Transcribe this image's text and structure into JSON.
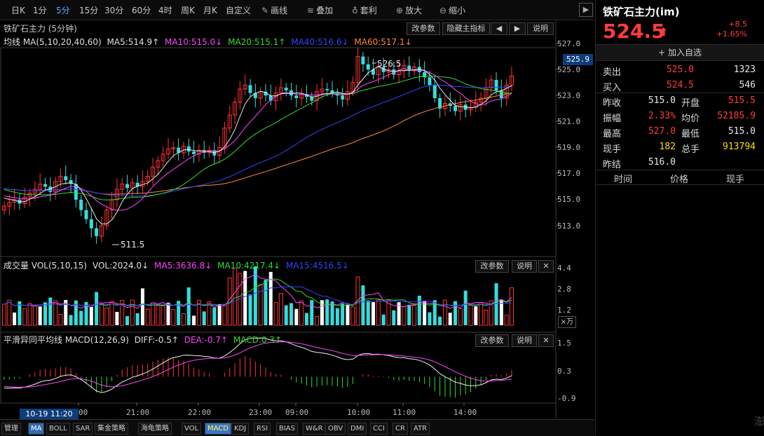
{
  "toolbar": {
    "items": [
      "日K",
      "1分",
      "5分",
      "15分",
      "30分",
      "60分",
      "4时",
      "周K",
      "月K",
      "自定义"
    ],
    "active_index": 2,
    "tools": [
      {
        "icon": "pencil-icon",
        "label": "画线"
      },
      {
        "icon": "layers-icon",
        "label": "叠加"
      },
      {
        "icon": "money-bag-icon",
        "label": "套利"
      },
      {
        "icon": "zoom-in-icon",
        "label": "放大"
      },
      {
        "icon": "zoom-out-icon",
        "label": "缩小"
      }
    ]
  },
  "main_panel": {
    "title": "铁矿石主力 (5分钟)",
    "buttons": [
      "改参数",
      "隐藏主指标",
      "◀",
      "▶",
      "说明"
    ],
    "ma_legend": [
      {
        "text": "均线 MA(5,10,20,40,60)",
        "color": "#e0e0e0"
      },
      {
        "text": "MA5:514.9↑",
        "color": "#e0e0e0"
      },
      {
        "text": "MA10:515.0↓",
        "color": "#ff44ff"
      },
      {
        "text": "MA20:515.1↑",
        "color": "#33dd33"
      },
      {
        "text": "MA40:516.6↓",
        "color": "#3344ff"
      },
      {
        "text": "MA60:517.1↓",
        "color": "#ff8833"
      }
    ],
    "y_ticks": [
      "527.0",
      "525.0",
      "523.0",
      "521.0",
      "519.0",
      "517.0",
      "515.0",
      "513.0"
    ],
    "current_price_tag": "525.9",
    "high_label": "526.5",
    "low_label": "511.5"
  },
  "volume_panel": {
    "legend": [
      {
        "text": "成交量 VOL(5,10,15)",
        "color": "#e0e0e0"
      },
      {
        "text": "VOL:2024.0↓",
        "color": "#e0e0e0"
      },
      {
        "text": "MA5:3636.8↓",
        "color": "#ff44ff"
      },
      {
        "text": "MA10:4217.4↓",
        "color": "#33dd33"
      },
      {
        "text": "MA15:4516.5↓",
        "color": "#3344ff"
      }
    ],
    "buttons": [
      "改参数",
      "说明",
      "✕"
    ],
    "y_ticks": [
      "4.4",
      "2.8",
      "1.2"
    ],
    "unit": "×万"
  },
  "macd_panel": {
    "legend": [
      {
        "text": "平滑异同平均线 MACD(12,26,9)",
        "color": "#e0e0e0"
      },
      {
        "text": "DIFF:-0.5↑",
        "color": "#e0e0e0"
      },
      {
        "text": "DEA:-0.7↑",
        "color": "#ff44ff"
      },
      {
        "text": "MACD:0.3↑",
        "color": "#33dd33"
      }
    ],
    "buttons": [
      "改参数",
      "说明",
      "✕"
    ],
    "y_ticks": [
      "1.5",
      "0.3",
      "-0.9"
    ]
  },
  "time_axis": {
    "labels": [
      "21:00",
      "22:00",
      "23:00",
      "09:00",
      "10:00",
      "11:00",
      "14:00"
    ],
    "partial_label": "00",
    "cursor_label": "10-19 11:20"
  },
  "bottom_tabs": {
    "items": [
      "管理",
      "MA",
      "BOLL",
      "SAR",
      "集金策略",
      "海龟策略",
      "VOL",
      "MACD",
      "KDJ",
      "RSI",
      "BIAS",
      "W&R",
      "OBV",
      "DMI",
      "CCI",
      "CR",
      "ATR"
    ],
    "active": [
      "MA"
    ],
    "highlighted": [
      "MACD"
    ]
  },
  "quote": {
    "name": "铁矿石主力(im)",
    "price": "524.5",
    "change": "+8.5",
    "change_pct": "+1.65%",
    "add_watchlist": "加入自选",
    "sell": {
      "label": "卖出",
      "price": "525.0",
      "vol": "1323"
    },
    "buy": {
      "label": "买入",
      "price": "524.5",
      "vol": "546"
    },
    "rows": [
      {
        "l1": "昨收",
        "v1": "515.0",
        "c1": "#e8e8e8",
        "l2": "开盘",
        "v2": "515.5",
        "c2": "#ff3b3b"
      },
      {
        "l1": "振幅",
        "v1": "2.33%",
        "c1": "#ff3b3b",
        "l2": "均价",
        "v2": "52185.9",
        "c2": "#ff3b3b"
      },
      {
        "l1": "最高",
        "v1": "527.0",
        "c1": "#ff3b3b",
        "l2": "最低",
        "v2": "515.0",
        "c2": "#e8e8e8"
      },
      {
        "l1": "现手",
        "v1": "182",
        "c1": "#f5e000",
        "l2": "总手",
        "v2": "913794",
        "c2": "#f5e000"
      }
    ],
    "settle": {
      "label": "昨结",
      "value": "516.0"
    },
    "trade_headers": [
      "时间",
      "价格",
      "现手"
    ],
    "watermark": "澎"
  }
}
